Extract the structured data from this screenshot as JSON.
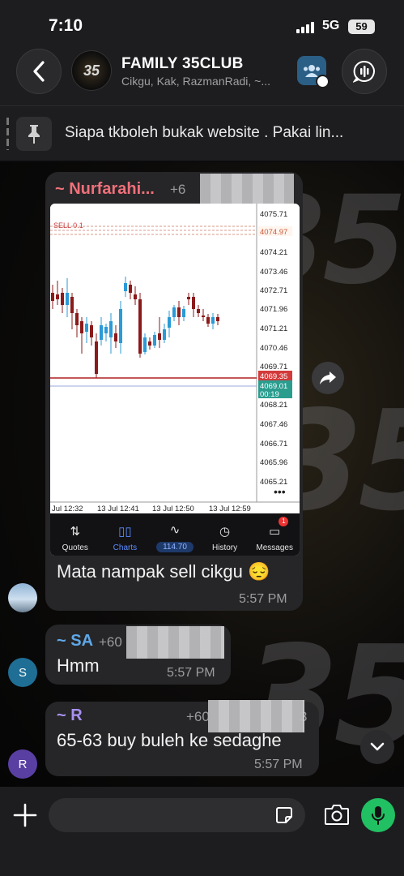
{
  "status_bar": {
    "time": "7:10",
    "network": "5G",
    "battery": "59"
  },
  "header": {
    "title": "FAMILY 35CLUB",
    "subtitle": "Cikgu, Kak, RazmanRadi, ~...",
    "avatar_text": "35"
  },
  "pinned": {
    "text": "Siapa tkboleh bukak website . Pakai lin..."
  },
  "messages": [
    {
      "sender": "~ Nurfarahi...",
      "phone": "+6",
      "text": "Mata nampak sell cikgu 😔",
      "time": "5:57 PM",
      "sender_color": "#f0707a",
      "chart": {
        "price_labels": [
          "4075.71",
          "4074.97",
          "4074.21",
          "4073.46",
          "4072.71",
          "4071.96",
          "4071.21",
          "4070.46",
          "4069.71",
          "4069.35",
          "4069.01",
          "00:19",
          "4068.21",
          "4067.46",
          "4066.71",
          "4065.96",
          "4065.21"
        ],
        "time_labels": [
          "Jul 12:32",
          "13 Jul 12:41",
          "13 Jul 12:50",
          "13 Jul 12:59"
        ],
        "order_label": "SELL 0.1",
        "tabs": [
          {
            "label": "Quotes",
            "icon": "quotes-icon"
          },
          {
            "label": "Charts",
            "icon": "charts-icon"
          },
          {
            "label": "114.70",
            "icon": "trade-icon"
          },
          {
            "label": "History",
            "icon": "history-icon"
          },
          {
            "label": "Messages",
            "icon": "messages-icon",
            "badge": "1"
          }
        ]
      }
    },
    {
      "sender": "~ SA",
      "phone": "+60",
      "text": "Hmm",
      "time": "5:57 PM",
      "avatar_letter": "S",
      "sender_color": "#5fa8e8"
    },
    {
      "sender": "~ R",
      "phone": "+60",
      "phone_suffix": "3",
      "text": "65-63 buy buleh ke sedaghe",
      "time": "5:57 PM",
      "avatar_letter": "R",
      "sender_color": "#a991f2"
    }
  ],
  "composer": {
    "placeholder": ""
  },
  "colors": {
    "accent_green": "#21c063",
    "bubble": "#262628",
    "header": "#1d1d1f"
  }
}
